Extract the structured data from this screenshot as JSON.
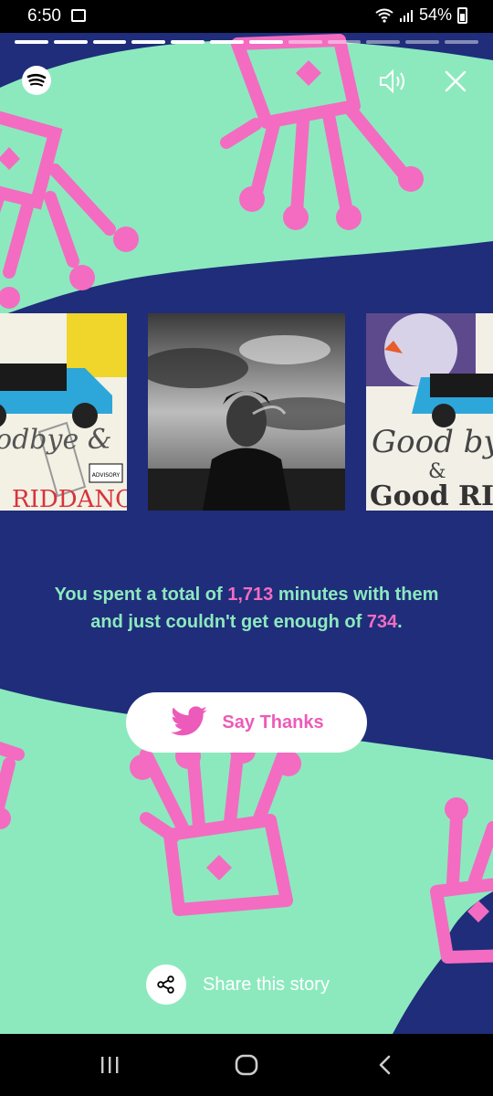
{
  "status_bar": {
    "time": "6:50",
    "battery": "54%",
    "icons": [
      "gallery-icon",
      "wifi-icon",
      "signal-icon",
      "battery-icon"
    ]
  },
  "story": {
    "progress": {
      "segments": 12,
      "completed": 7
    },
    "brand_icon": "spotify-icon",
    "controls": {
      "volume_icon": "volume-icon",
      "close_icon": "close-icon"
    },
    "albums": [
      {
        "title": "Goodbye & Good Riddance",
        "cover_text": [
          "Goodbye &",
          "RIDDANCE"
        ]
      },
      {
        "title": "Artist photo"
      },
      {
        "title": "Goodbye & Good Riddance",
        "cover_text": [
          "Good bye",
          "&",
          "Good RIDD"
        ]
      }
    ],
    "summary": {
      "p1": "You spent a total of ",
      "minutes": "1,713",
      "p2": " minutes with them and just couldn't get enough of ",
      "song": "734",
      "p3": "."
    },
    "thanks_button": {
      "label": "Say Thanks",
      "icon": "twitter-icon"
    },
    "share": {
      "label": "Share this story",
      "icon": "share-icon"
    },
    "colors": {
      "background": "#1F2D7A",
      "mint": "#8CE9BE",
      "pink": "#F36CC1",
      "text_highlight": "#F36CC1"
    }
  },
  "nav": {
    "icons": [
      "recents-icon",
      "home-icon",
      "back-icon"
    ]
  }
}
